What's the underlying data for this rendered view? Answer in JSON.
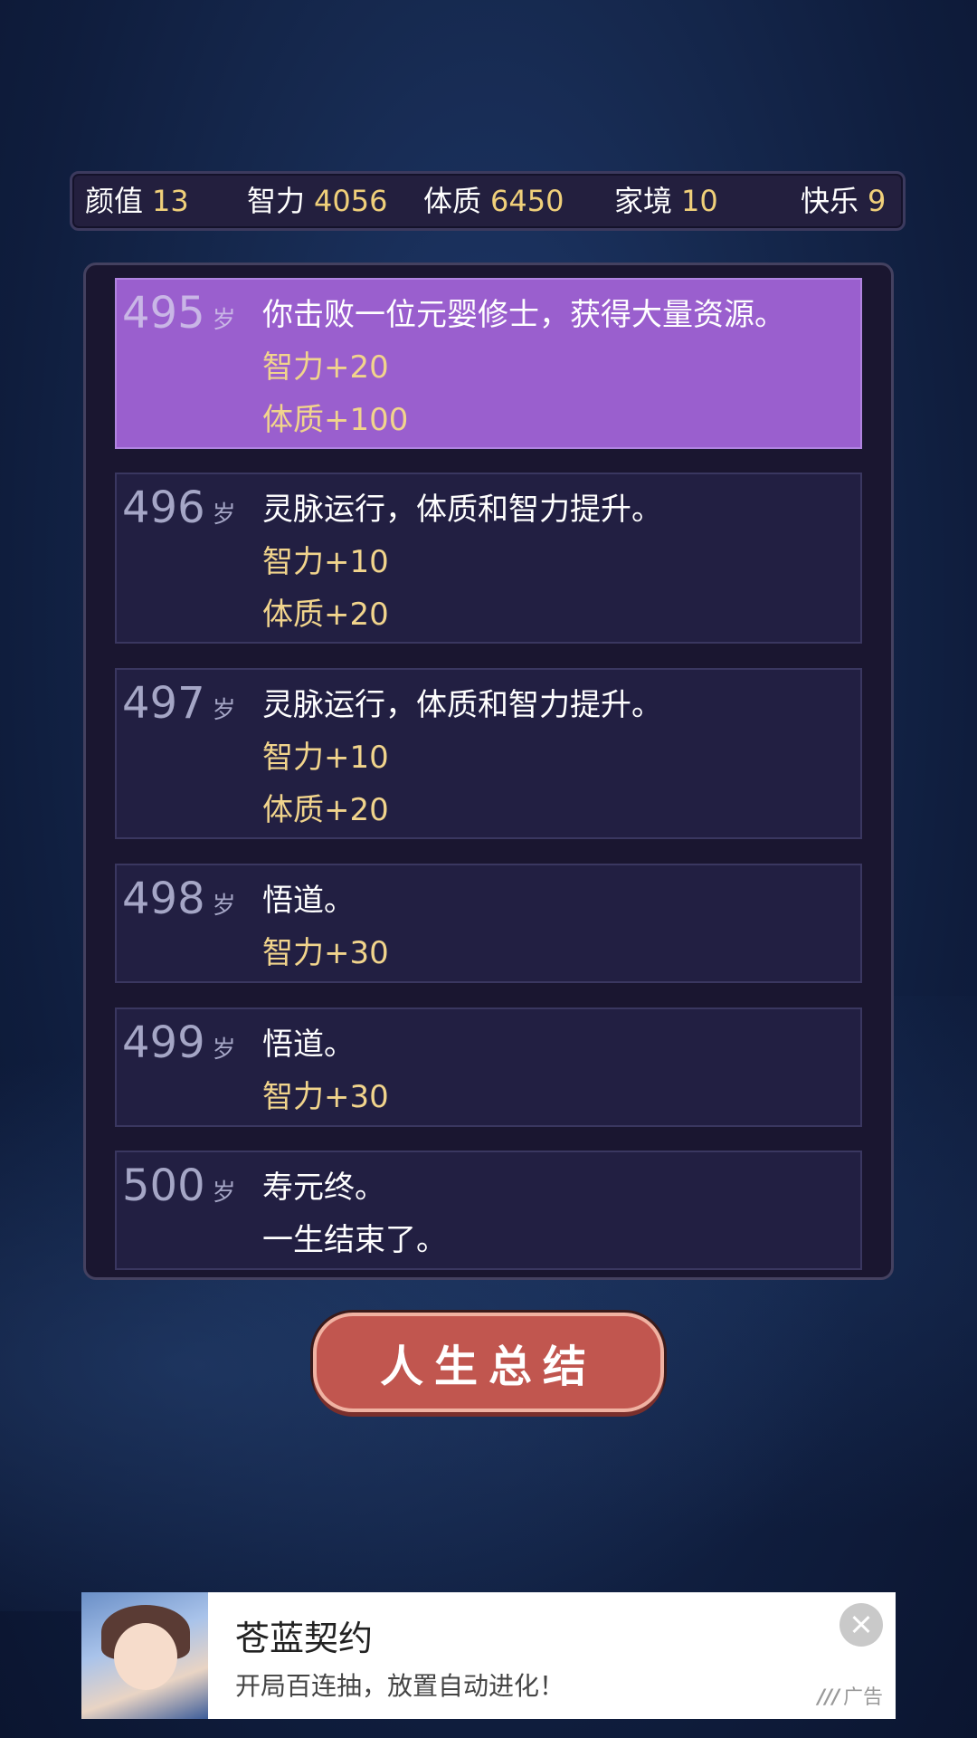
{
  "stats": [
    {
      "label": "颜值",
      "value": "13"
    },
    {
      "label": "智力",
      "value": "4056"
    },
    {
      "label": "体质",
      "value": "6450"
    },
    {
      "label": "家境",
      "value": "10"
    },
    {
      "label": "快乐",
      "value": "9"
    }
  ],
  "age_unit": "岁",
  "entries": [
    {
      "age": "495",
      "lines": [
        "你击败一位元婴修士，获得大量资源。"
      ],
      "effects": [
        "智力+20",
        "体质+100"
      ]
    },
    {
      "age": "496",
      "lines": [
        "灵脉运行，体质和智力提升。"
      ],
      "effects": [
        "智力+10",
        "体质+20"
      ]
    },
    {
      "age": "497",
      "lines": [
        "灵脉运行，体质和智力提升。"
      ],
      "effects": [
        "智力+10",
        "体质+20"
      ]
    },
    {
      "age": "498",
      "lines": [
        "悟道。"
      ],
      "effects": [
        "智力+30"
      ]
    },
    {
      "age": "499",
      "lines": [
        "悟道。"
      ],
      "effects": [
        "智力+30"
      ]
    },
    {
      "age": "500",
      "lines": [
        "寿元终。",
        "一生结束了。"
      ],
      "effects": []
    }
  ],
  "summary_button": "人生总结",
  "ad": {
    "title": "苍蓝契约",
    "description": "开局百连抽，放置自动进化！",
    "tag": "广告",
    "tag_mark": "///"
  },
  "colors": {
    "highlight": "#9a5fce",
    "effect_text": "#f1d48c",
    "button": "#c1564f"
  }
}
